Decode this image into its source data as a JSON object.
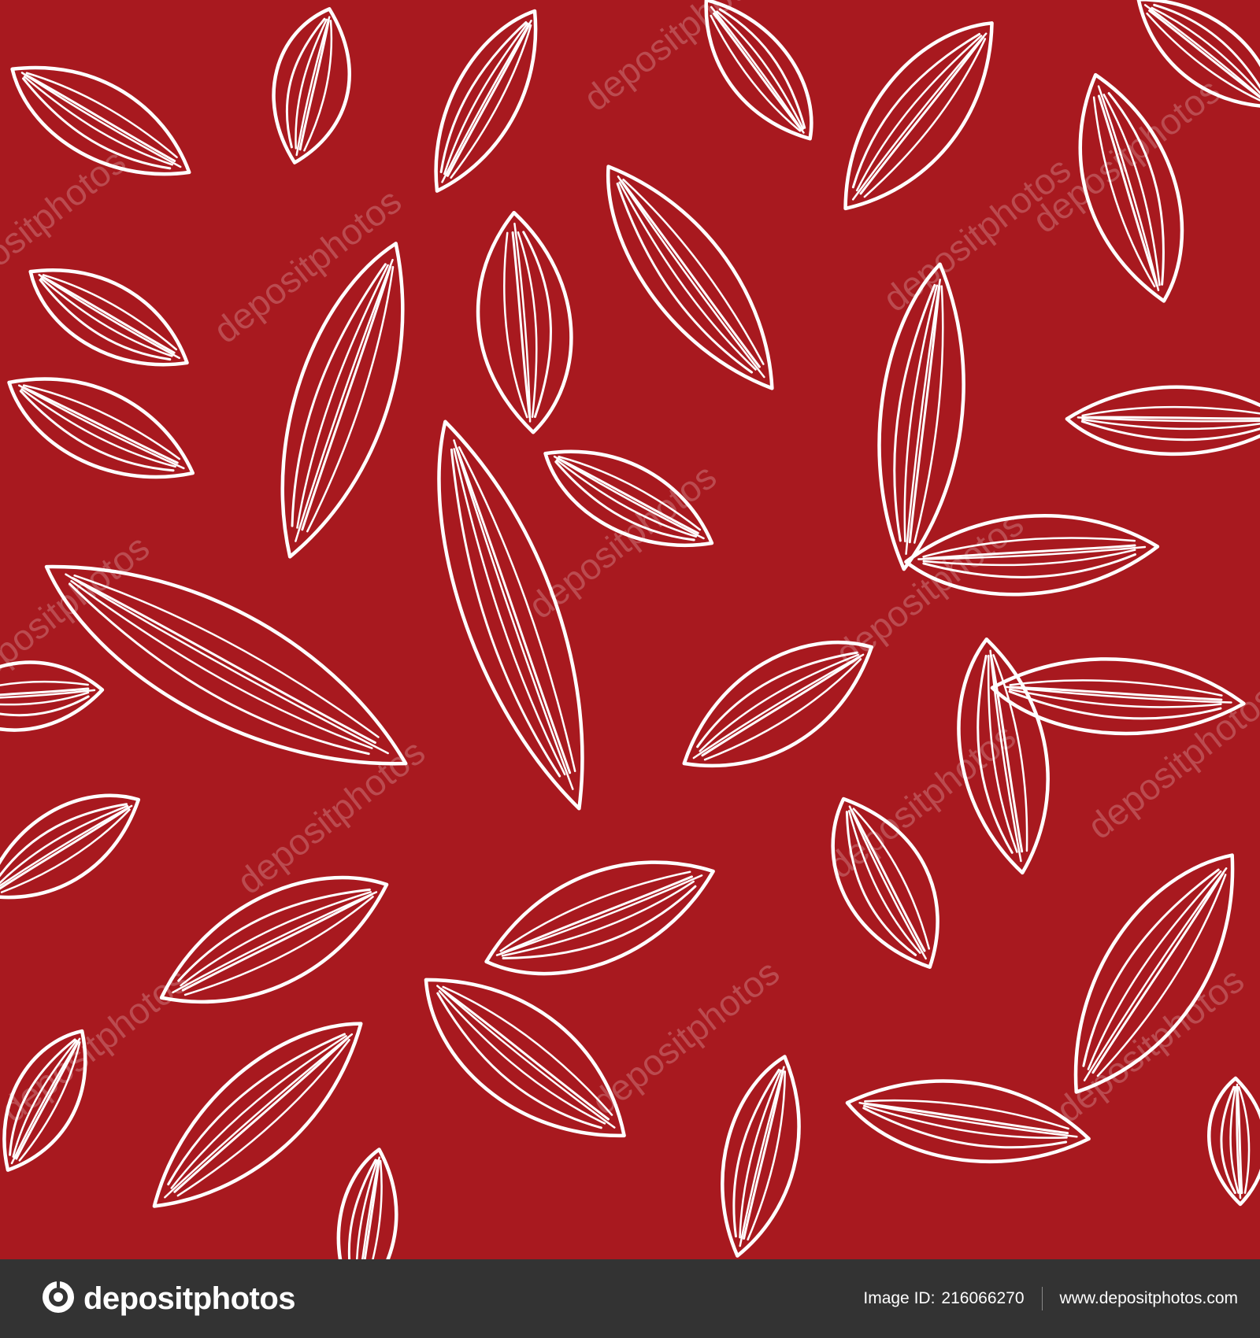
{
  "colors": {
    "background": "#a8191f",
    "leaf_stroke": "#ffffff",
    "footer_background": "#333333",
    "footer_text": "#ffffff",
    "watermark": "#ffffff"
  },
  "artwork": {
    "pattern": "seamless white outline leaves on red",
    "watermark_text": "depositphotos"
  },
  "footer": {
    "logo_icon": "camera-lens-icon",
    "brand_name": "depositphotos",
    "image_id_label": "Image ID:",
    "image_id_value": "216066270",
    "site_url": "www.depositphotos.com"
  }
}
